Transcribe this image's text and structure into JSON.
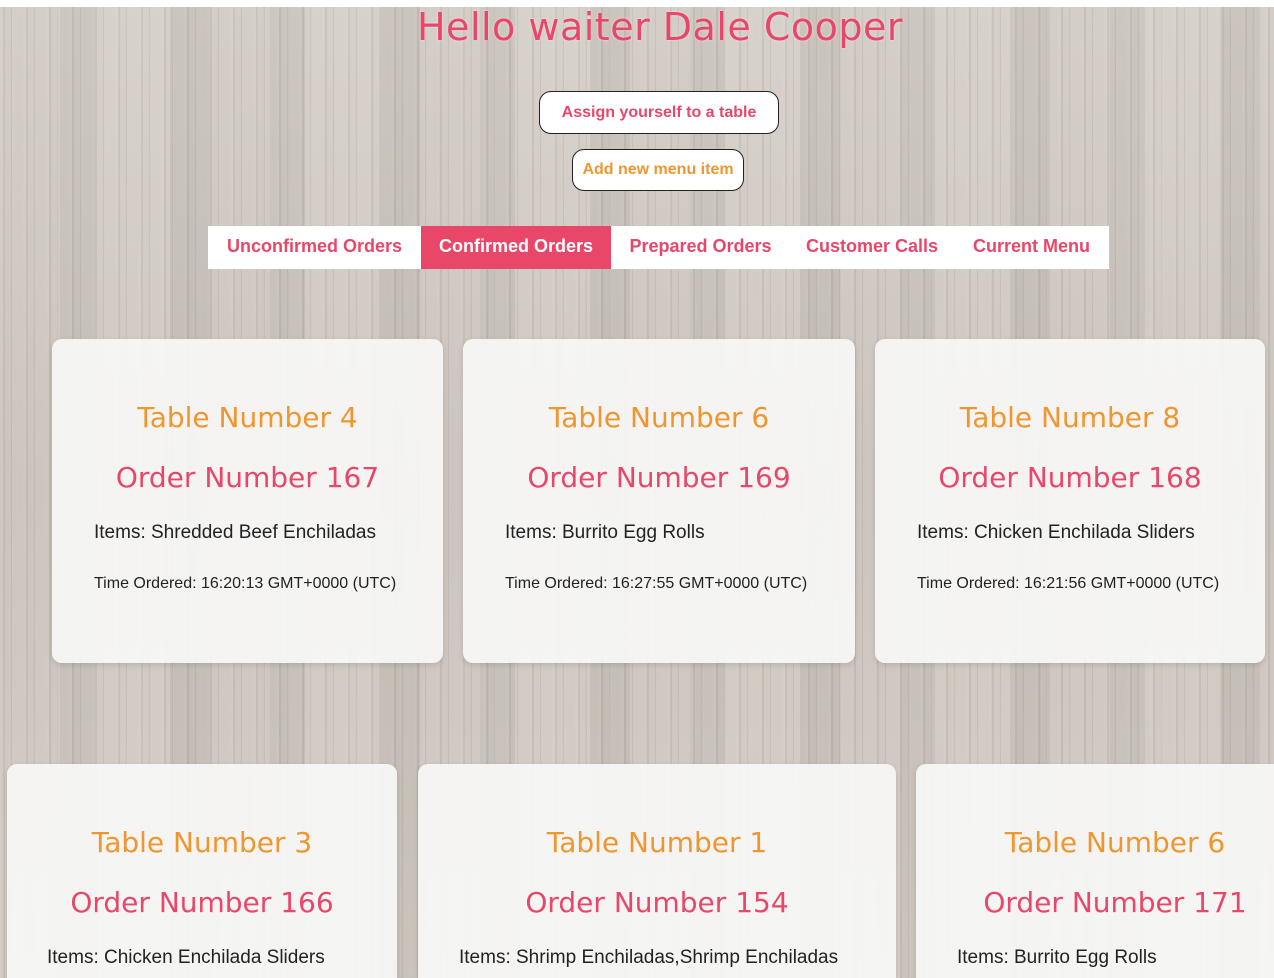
{
  "header": {
    "greeting": "Hello waiter Dale Cooper",
    "assign_button": "Assign yourself to a table",
    "add_menu_button": "Add new menu item"
  },
  "tabs": [
    {
      "label": "Unconfirmed Orders",
      "active": false
    },
    {
      "label": "Confirmed Orders",
      "active": true
    },
    {
      "label": "Prepared Orders",
      "active": false
    },
    {
      "label": "Customer Calls",
      "active": false
    },
    {
      "label": "Current Menu",
      "active": false
    }
  ],
  "orders": [
    {
      "table": "Table Number 4",
      "order": "Order Number 167",
      "items": "Items: Shredded Beef Enchiladas",
      "time": "Time Ordered: 16:20:13 GMT+0000 (UTC)"
    },
    {
      "table": "Table Number 6",
      "order": "Order Number 169",
      "items": "Items: Burrito Egg Rolls",
      "time": "Time Ordered: 16:27:55 GMT+0000 (UTC)"
    },
    {
      "table": "Table Number 8",
      "order": "Order Number 168",
      "items": "Items: Chicken Enchilada Sliders",
      "time": "Time Ordered: 16:21:56 GMT+0000 (UTC)"
    },
    {
      "table": "Table Number 3",
      "order": "Order Number 166",
      "items": "Items: Chicken Enchilada Sliders",
      "time": ""
    },
    {
      "table": "Table Number 1",
      "order": "Order Number 154",
      "items": "Items: Shrimp Enchiladas,Shrimp Enchiladas",
      "time": ""
    },
    {
      "table": "Table Number 6",
      "order": "Order Number 171",
      "items": "Items: Burrito Egg Rolls",
      "time": ""
    }
  ],
  "colors": {
    "accent_pink": "#e8476a",
    "accent_orange": "#f0962f"
  }
}
